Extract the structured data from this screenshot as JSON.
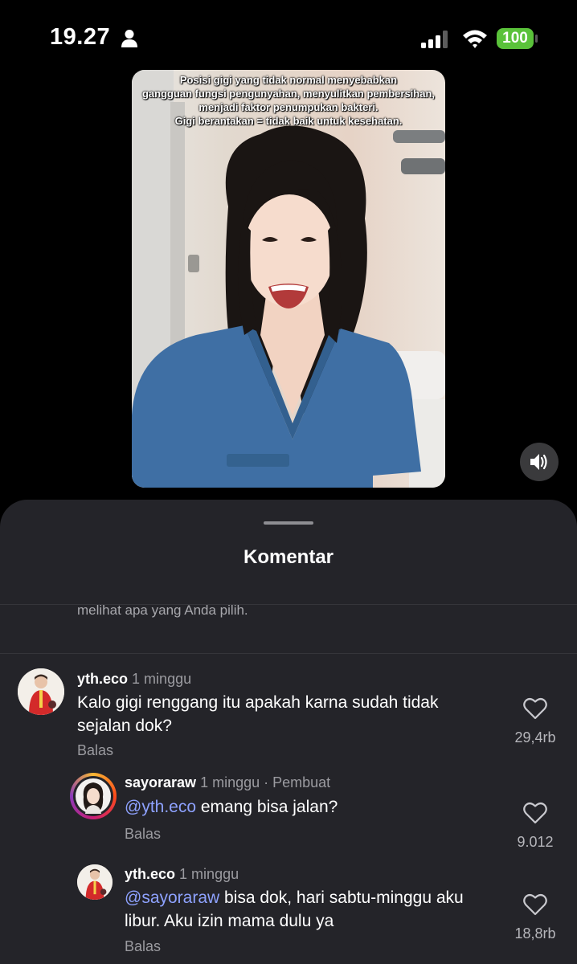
{
  "status_bar": {
    "time": "19.27",
    "battery": "100"
  },
  "video": {
    "caption_lines": [
      "Posisi gigi yang tidak normal menyebabkan",
      "gangguan fungsi pengunyahan, menyulitkan pembersihan,",
      "menjadi faktor penumpukan bakteri.",
      "Gigi berantakan = tidak baik untuk kesehatan."
    ]
  },
  "sheet": {
    "title": "Komentar",
    "notice": "melihat apa yang Anda pilih."
  },
  "comments": [
    {
      "user": "yth.eco",
      "ago": "1 minggu",
      "creator": "",
      "mention": "",
      "body": "Kalo gigi renggang itu apakah karna sudah tidak sejalan dok?",
      "reply_label": "Balas",
      "likes": "29,4rb"
    },
    {
      "user": "sayoraraw",
      "ago": "1 minggu",
      "creator": " · Pembuat",
      "mention": "@yth.eco",
      "body": " emang bisa jalan?",
      "reply_label": "Balas",
      "likes": "9.012"
    },
    {
      "user": "yth.eco",
      "ago": "1 minggu",
      "creator": "",
      "mention": "@sayoraraw",
      "body": " bisa dok, hari sabtu-minggu aku libur. Aku izin mama dulu ya",
      "reply_label": "Balas",
      "likes": "18,8rb"
    }
  ]
}
